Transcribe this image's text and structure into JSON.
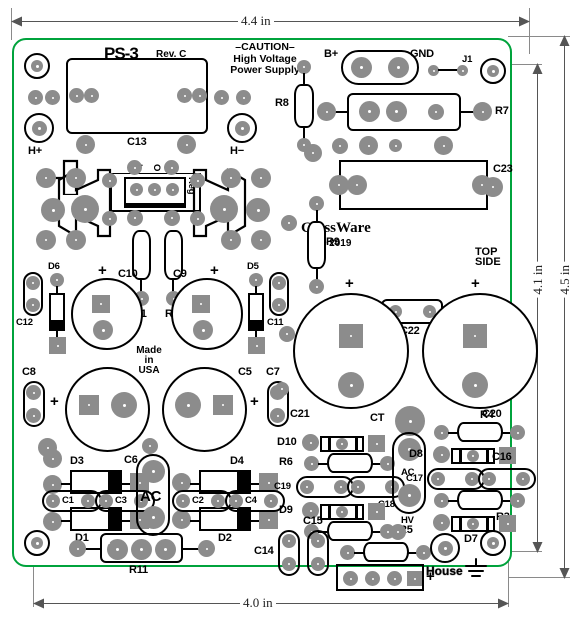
{
  "board": {
    "title": "PS-3",
    "revision": "Rev. C",
    "caution_line1": "–CAUTION–",
    "caution_line2": "High Voltage",
    "caution_line3": "Power Supply",
    "brand": "GlassWare",
    "copyright": "© 2019",
    "made_in": [
      "Made",
      "in",
      "USA"
    ],
    "side_note": [
      "TOP",
      "SIDE"
    ],
    "border_color": "#00a33c",
    "pad_color": "#8c8c8c"
  },
  "dimensions": {
    "top": "4.4 in",
    "bottom": "4.0 in",
    "right_inner": "4.1 in",
    "right_outer": "4.5 in"
  },
  "terminals": {
    "h_plus": "H+",
    "h_minus": "H−",
    "b_plus": "B+",
    "gnd": "GND",
    "j1": "J1",
    "ac_left": "AC",
    "ac_right": "AC",
    "ct": "CT",
    "hv": "HV",
    "house": "House"
  },
  "regulator": {
    "name": "Reg",
    "pins": [
      "I",
      "O",
      "A"
    ]
  },
  "capacitors": [
    "C1",
    "C2",
    "C3",
    "C4",
    "C5",
    "C6",
    "C7",
    "C8",
    "C9",
    "C10",
    "C11",
    "C12",
    "C13",
    "C14",
    "C15",
    "C16",
    "C17",
    "C18",
    "C19",
    "C20",
    "C21",
    "C22",
    "C23"
  ],
  "resistors": [
    "R1",
    "R2",
    "R3",
    "R4",
    "R5",
    "R6",
    "R7",
    "R8",
    "R9",
    "R10",
    "R11"
  ],
  "diodes": [
    "D1",
    "D2",
    "D3",
    "D4",
    "D5",
    "D6",
    "D7",
    "D8",
    "D9",
    "D10"
  ],
  "refdes": {
    "C1": "C1",
    "C2": "C2",
    "C3": "C3",
    "C4": "C4",
    "C5": "C5",
    "C6": "C6",
    "C7": "C7",
    "C8": "C8",
    "C9": "C9",
    "C10": "C10",
    "C11": "C11",
    "C12": "C12",
    "C13": "C13",
    "C14": "C14",
    "C15": "C15",
    "C16": "C16",
    "C17": "C17",
    "C18": "C18",
    "C19": "C19",
    "C20": "C20",
    "C21": "C21",
    "C22": "C22",
    "C23": "C23",
    "R1": "R1",
    "R2": "R2",
    "R3": "R3",
    "R4": "R4",
    "R5": "R5",
    "R6": "R6",
    "R7": "R7",
    "R8": "R8",
    "R9": "R9",
    "R10": "R10",
    "R11": "R11",
    "D1": "D1",
    "D2": "D2",
    "D3": "D3",
    "D4": "D4",
    "D5": "D5",
    "D6": "D6",
    "D7": "D7",
    "D8": "D8",
    "D9": "D9",
    "D10": "D10"
  },
  "polarity_marks": {
    "c10": "+",
    "c9": "+",
    "c8": "+",
    "c5": "+",
    "c21": "+",
    "c20": "+",
    "c15_row": "+"
  }
}
